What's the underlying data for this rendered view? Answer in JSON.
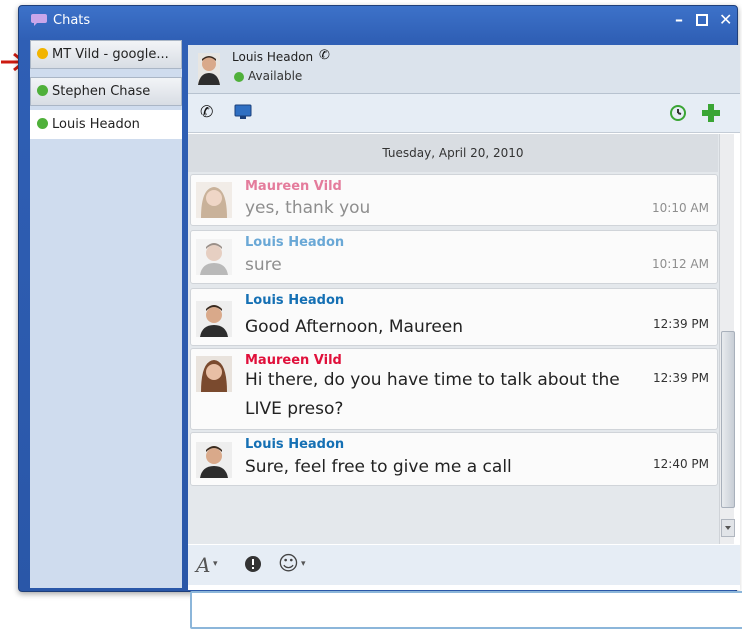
{
  "window": {
    "title": "Chats"
  },
  "tabs": [
    {
      "label": "MT Vild - google...",
      "status": "away",
      "status_color": "#f2b400"
    },
    {
      "label": "Stephen Chase",
      "status": "available",
      "status_color": "#4fb03a"
    },
    {
      "label": "Louis Headon",
      "status": "available",
      "status_color": "#4fb03a"
    }
  ],
  "contact": {
    "name": "Louis Headon",
    "status": "Available"
  },
  "conversation": {
    "date": "Tuesday, April 20, 2010",
    "messages": [
      {
        "sender": "Maureen Vild",
        "text": "yes, thank you",
        "time": "10:10 AM",
        "sender_color": "#e47c9c"
      },
      {
        "sender": "Louis Headon",
        "text": "sure",
        "time": "10:12 AM",
        "sender_color": "#6aa8d6"
      },
      {
        "sender": "Louis Headon",
        "text": "Good Afternoon, Maureen",
        "time": "12:39 PM",
        "sender_color": "#1570b4"
      },
      {
        "sender": "Maureen Vild",
        "text": "Hi there, do you have time to talk about the LIVE preso?",
        "time": "12:39 PM",
        "sender_color": "#e0103b"
      },
      {
        "sender": "Louis Headon",
        "text": "Sure, feel free to give me a call",
        "time": "12:40 PM",
        "sender_color": "#1570b4"
      }
    ]
  },
  "input": {
    "value": "",
    "placeholder": ""
  }
}
